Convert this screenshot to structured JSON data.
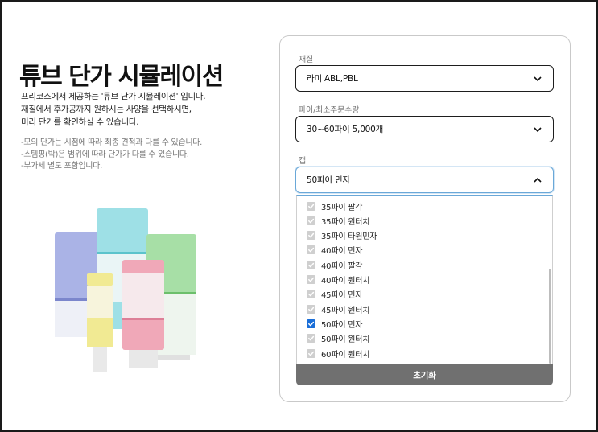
{
  "page": {
    "title": "튜브 단가 시뮬레이션",
    "intro_lines": [
      "프리코스에서 제공하는 '튜브 단가 시뮬레이션' 입니다.",
      "재질에서 후가공까지 원하시는 사양을 선택하시면,",
      "미리 단가를 확인하실 수 있습니다."
    ],
    "notes": [
      "-모의 단가는 시점에 따라 최종 견적과 다를 수 있습니다.",
      "-스템핑(박)은 범위에 따라 단가가 다를 수 있습니다.",
      "-부가세 별도 포함입니다."
    ]
  },
  "form": {
    "material": {
      "label": "재질",
      "value": "라미 ABL,PBL"
    },
    "diameter_moq": {
      "label": "파이/최소주문수량",
      "value": "30~60파이 5,000개"
    },
    "cap": {
      "label": "캡",
      "value": "50파이 민자",
      "options": [
        {
          "label": "35파이 팔각",
          "checked": false
        },
        {
          "label": "35파이 원터치",
          "checked": false
        },
        {
          "label": "35파이 타원민자",
          "checked": false
        },
        {
          "label": "40파이 민자",
          "checked": false
        },
        {
          "label": "40파이 팔각",
          "checked": false
        },
        {
          "label": "40파이 원터치",
          "checked": false
        },
        {
          "label": "45파이 민자",
          "checked": false
        },
        {
          "label": "45파이 원터치",
          "checked": false
        },
        {
          "label": "50파이 민자",
          "checked": true
        },
        {
          "label": "50파이 원터치",
          "checked": false
        },
        {
          "label": "60파이 원터치",
          "checked": false
        }
      ]
    },
    "reset_label": "초기화"
  },
  "colors": {
    "accent": "#1a6ed8",
    "focus_border": "#6aa8d8",
    "reset_bg": "#707070",
    "tube_lavender": "#aab3e6",
    "tube_cyan": "#9ee0e6",
    "tube_mint": "#a7dfa6",
    "tube_pink": "#f0a8b8",
    "tube_yellow": "#f1ea93"
  }
}
